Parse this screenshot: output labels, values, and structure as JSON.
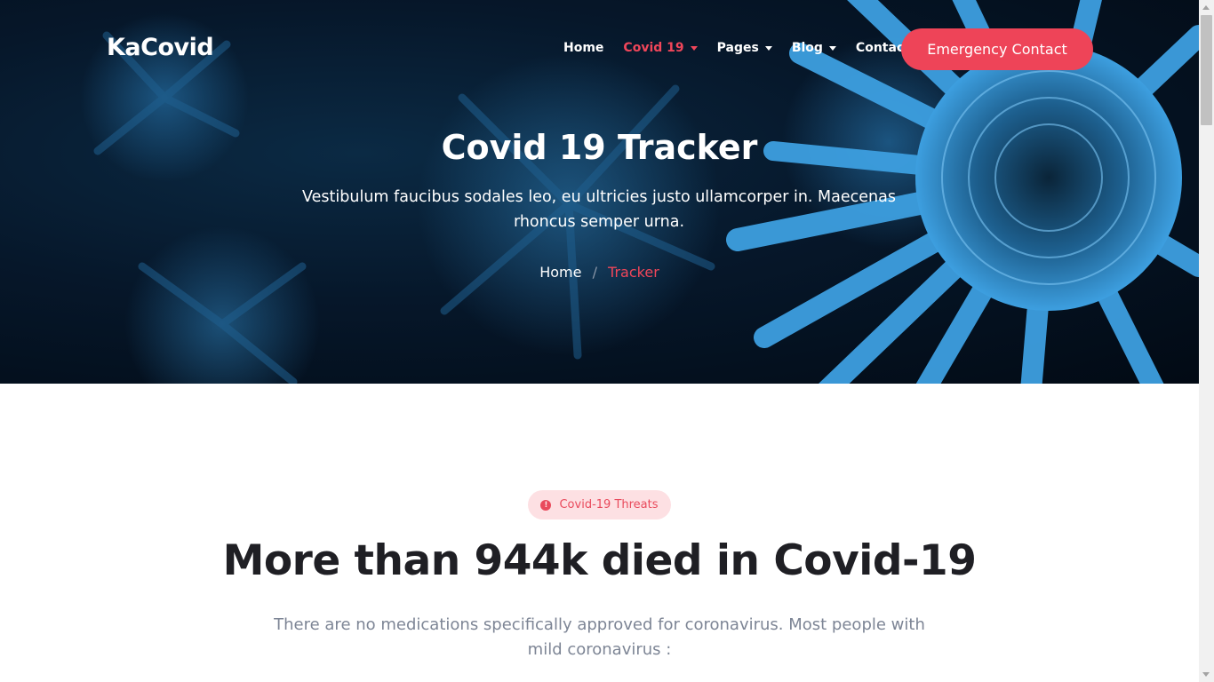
{
  "brand": {
    "logo": "KaCovid"
  },
  "nav": {
    "items": [
      {
        "label": "Home",
        "dropdown": false,
        "active": false
      },
      {
        "label": "Covid 19",
        "dropdown": true,
        "active": true
      },
      {
        "label": "Pages",
        "dropdown": true,
        "active": false
      },
      {
        "label": "Blog",
        "dropdown": true,
        "active": false
      },
      {
        "label": "Contact",
        "dropdown": false,
        "active": false
      }
    ],
    "cta_label": "Emergency Contact"
  },
  "hero": {
    "title": "Covid 19 Tracker",
    "subtitle": "Vestibulum faucibus sodales leo, eu ultricies justo ullamcorper in. Maecenas rhoncus semper urna.",
    "breadcrumb": {
      "home": "Home",
      "separator": "/",
      "current": "Tracker"
    }
  },
  "section": {
    "badge": {
      "icon": "info-circle-icon",
      "label": "Covid-19 Threats"
    },
    "title": "More than 944k died in Covid-19",
    "text": "There are no medications specifically approved for coronavirus. Most people with mild coronavirus :"
  },
  "colors": {
    "accent": "#ee4458",
    "badge_bg": "#fde0e3",
    "hero_bg": "#06172a",
    "virus": "#3d9fe0",
    "title": "#1f1f24",
    "body_text": "#7d8595"
  }
}
